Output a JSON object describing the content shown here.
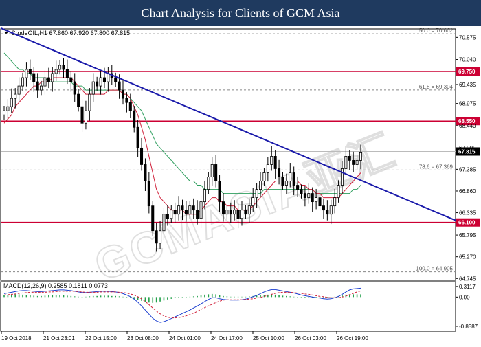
{
  "header": {
    "title": "Chart Analysis for Clients of GCM Asia"
  },
  "chart_data": [
    {
      "type": "candlestick",
      "title": "CrudeOIL,H1  67.860 67.920 67.800 67.815",
      "ohlc_label": "CrudeOIL,H1  67.860 67.920 67.800 67.815",
      "ylim": [
        64.7,
        70.78
      ],
      "y_ticks": [
        "70.575",
        "70.040",
        "69.435",
        "68.975",
        "68.440",
        "67.905",
        "67.385",
        "66.860",
        "66.335",
        "65.795",
        "65.270",
        "64.745"
      ],
      "x_ticks": [
        "19 Oct 2018",
        "21 Oct 23:01",
        "22 Oct 15:00",
        "23 Oct 08:00",
        "24 Oct 01:00",
        "24 Oct 17:00",
        "25 Oct 10:00",
        "26 Oct 03:00",
        "26 Oct 19:00"
      ],
      "current_price": "67.815",
      "horizontal_levels": [
        {
          "value": 69.75,
          "label": "69.750"
        },
        {
          "value": 68.55,
          "label": "68.550"
        },
        {
          "value": 66.1,
          "label": "66.100"
        }
      ],
      "fibonacci_levels": [
        {
          "value": 70.662,
          "label": "50.0 = 70.662"
        },
        {
          "value": 69.304,
          "label": "61.8 = 69.304"
        },
        {
          "value": 67.369,
          "label": "78.6 = 67.369"
        },
        {
          "value": 64.905,
          "label": "100.0 = 64.905"
        }
      ],
      "trendline": {
        "start_price": 70.8,
        "end_price": 66.15,
        "color": "#1a1aaa"
      },
      "closes": [
        68.8,
        68.9,
        69.1,
        69.2,
        69.4,
        69.6,
        69.8,
        69.7,
        69.5,
        69.3,
        69.4,
        69.6,
        69.5,
        69.7,
        69.8,
        69.9,
        69.8,
        69.6,
        69.5,
        69.2,
        68.9,
        68.5,
        68.8,
        69.2,
        69.5,
        69.4,
        69.6,
        69.5,
        69.7,
        69.6,
        69.5,
        69.3,
        69.1,
        69.0,
        68.8,
        68.4,
        67.9,
        67.5,
        67.1,
        66.5,
        65.9,
        65.6,
        65.9,
        66.3,
        66.2,
        66.4,
        66.3,
        66.5,
        66.4,
        66.3,
        66.5,
        66.4,
        66.2,
        66.6,
        66.9,
        67.2,
        67.5,
        67.1,
        66.6,
        66.3,
        66.4,
        66.3,
        66.4,
        66.2,
        66.4,
        66.3,
        66.5,
        66.7,
        66.9,
        67.1,
        67.3,
        67.5,
        67.7,
        67.4,
        67.2,
        67.0,
        67.1,
        67.3,
        67.0,
        66.9,
        66.8,
        66.7,
        66.8,
        66.6,
        66.7,
        66.5,
        66.4,
        66.3,
        66.5,
        66.7,
        67.0,
        67.4,
        67.7,
        67.6,
        67.5,
        67.6,
        67.8
      ],
      "ma_red": [
        68.5,
        68.6,
        68.7,
        68.9,
        69.0,
        69.1,
        69.2,
        69.3,
        69.4,
        69.4,
        69.5,
        69.5,
        69.5,
        69.6,
        69.6,
        69.6,
        69.6,
        69.6,
        69.6,
        69.5,
        69.4,
        69.3,
        69.2,
        69.2,
        69.2,
        69.2,
        69.2,
        69.2,
        69.3,
        69.3,
        69.3,
        69.3,
        69.2,
        69.2,
        69.1,
        68.9,
        68.7,
        68.4,
        68.1,
        67.7,
        67.3,
        66.9,
        66.7,
        66.6,
        66.5,
        66.4,
        66.4,
        66.4,
        66.4,
        66.3,
        66.3,
        66.3,
        66.3,
        66.4,
        66.5,
        66.6,
        66.7,
        66.7,
        66.6,
        66.6,
        66.5,
        66.5,
        66.5,
        66.4,
        66.4,
        66.4,
        66.4,
        66.5,
        66.6,
        66.7,
        66.8,
        66.9,
        67.0,
        67.1,
        67.1,
        67.1,
        67.1,
        67.1,
        67.1,
        67.1,
        67.0,
        67.0,
        66.9,
        66.9,
        66.8,
        66.8,
        66.7,
        66.7,
        66.7,
        66.7,
        66.7,
        66.8,
        66.9,
        67.0,
        67.1,
        67.2,
        67.3
      ],
      "ma_green": [
        70.2,
        70.1,
        70.0,
        69.9,
        69.8,
        69.8,
        69.7,
        69.7,
        69.6,
        69.6,
        69.6,
        69.6,
        69.5,
        69.5,
        69.5,
        69.5,
        69.5,
        69.5,
        69.5,
        69.4,
        69.4,
        69.4,
        69.3,
        69.3,
        69.3,
        69.3,
        69.3,
        69.3,
        69.3,
        69.3,
        69.3,
        69.3,
        69.2,
        69.2,
        69.1,
        69.0,
        68.9,
        68.8,
        68.6,
        68.4,
        68.2,
        68.0,
        67.9,
        67.8,
        67.7,
        67.6,
        67.5,
        67.4,
        67.3,
        67.2,
        67.1,
        67.1,
        67.0,
        67.0,
        66.9,
        66.9,
        66.9,
        66.9,
        66.9,
        66.8,
        66.8,
        66.8,
        66.8,
        66.8,
        66.8,
        66.8,
        66.8,
        66.8,
        66.8,
        66.8,
        66.9,
        66.9,
        66.9,
        66.9,
        66.9,
        66.9,
        66.9,
        66.9,
        66.9,
        66.9,
        66.9,
        66.9,
        66.9,
        66.9,
        66.8,
        66.8,
        66.8,
        66.8,
        66.8,
        66.8,
        66.8,
        66.8,
        66.8,
        66.8,
        66.9,
        66.9,
        67.0
      ]
    },
    {
      "type": "macd",
      "title": "MACD(12,26,9) 0.2585 0.1811 0.0773",
      "label": "MACD(12,26,9) 0.2585 0.1811 0.0773",
      "ylim": [
        -1.0,
        0.45
      ],
      "y_ticks": [
        "0.3117",
        "0.00",
        "-0.8587"
      ],
      "histogram": [
        0.05,
        0.06,
        0.07,
        0.08,
        0.08,
        0.07,
        0.06,
        0.05,
        0.04,
        0.03,
        0.03,
        0.04,
        0.05,
        0.05,
        0.06,
        0.06,
        0.05,
        0.04,
        0.03,
        0.02,
        0.01,
        0.0,
        0.01,
        0.02,
        0.03,
        0.03,
        0.04,
        0.04,
        0.04,
        0.03,
        0.03,
        0.02,
        0.01,
        -0.01,
        -0.03,
        -0.05,
        -0.08,
        -0.11,
        -0.14,
        -0.16,
        -0.17,
        -0.16,
        -0.13,
        -0.1,
        -0.07,
        -0.05,
        -0.03,
        -0.02,
        -0.01,
        0.0,
        0.01,
        0.02,
        0.03,
        0.05,
        0.07,
        0.08,
        0.09,
        0.08,
        0.05,
        0.03,
        0.02,
        0.01,
        0.01,
        0.01,
        0.01,
        0.01,
        0.02,
        0.03,
        0.04,
        0.05,
        0.06,
        0.07,
        0.08,
        0.07,
        0.05,
        0.04,
        0.03,
        0.02,
        0.01,
        0.0,
        -0.01,
        -0.02,
        -0.02,
        -0.03,
        -0.03,
        -0.03,
        -0.03,
        -0.02,
        -0.01,
        0.01,
        0.03,
        0.05,
        0.07,
        0.08,
        0.08,
        0.08,
        0.08
      ],
      "macd": [
        0.1,
        0.12,
        0.14,
        0.16,
        0.18,
        0.19,
        0.19,
        0.18,
        0.17,
        0.16,
        0.16,
        0.17,
        0.18,
        0.19,
        0.2,
        0.21,
        0.21,
        0.2,
        0.19,
        0.17,
        0.15,
        0.13,
        0.13,
        0.14,
        0.15,
        0.16,
        0.17,
        0.17,
        0.17,
        0.16,
        0.15,
        0.13,
        0.1,
        0.06,
        0.01,
        -0.06,
        -0.15,
        -0.26,
        -0.38,
        -0.5,
        -0.62,
        -0.7,
        -0.74,
        -0.72,
        -0.68,
        -0.63,
        -0.58,
        -0.53,
        -0.48,
        -0.43,
        -0.38,
        -0.32,
        -0.26,
        -0.2,
        -0.13,
        -0.07,
        -0.02,
        -0.02,
        -0.05,
        -0.07,
        -0.08,
        -0.09,
        -0.09,
        -0.09,
        -0.08,
        -0.06,
        -0.03,
        0.01,
        0.05,
        0.1,
        0.15,
        0.19,
        0.22,
        0.22,
        0.2,
        0.18,
        0.16,
        0.14,
        0.12,
        0.09,
        0.06,
        0.04,
        0.02,
        0.0,
        -0.02,
        -0.03,
        -0.05,
        -0.06,
        -0.05,
        -0.02,
        0.02,
        0.08,
        0.15,
        0.21,
        0.24,
        0.25,
        0.26
      ],
      "signal": [
        0.06,
        0.07,
        0.08,
        0.09,
        0.11,
        0.12,
        0.13,
        0.14,
        0.14,
        0.14,
        0.14,
        0.14,
        0.15,
        0.15,
        0.16,
        0.17,
        0.17,
        0.17,
        0.17,
        0.17,
        0.16,
        0.15,
        0.14,
        0.14,
        0.14,
        0.14,
        0.15,
        0.15,
        0.15,
        0.15,
        0.15,
        0.14,
        0.13,
        0.12,
        0.09,
        0.06,
        0.01,
        -0.05,
        -0.13,
        -0.22,
        -0.32,
        -0.41,
        -0.49,
        -0.55,
        -0.59,
        -0.61,
        -0.61,
        -0.6,
        -0.58,
        -0.55,
        -0.51,
        -0.47,
        -0.42,
        -0.36,
        -0.31,
        -0.26,
        -0.21,
        -0.16,
        -0.12,
        -0.09,
        -0.08,
        -0.08,
        -0.08,
        -0.08,
        -0.08,
        -0.07,
        -0.06,
        -0.05,
        -0.03,
        -0.01,
        0.02,
        0.05,
        0.08,
        0.11,
        0.13,
        0.14,
        0.14,
        0.14,
        0.13,
        0.12,
        0.11,
        0.09,
        0.08,
        0.06,
        0.04,
        0.02,
        0.01,
        -0.01,
        -0.02,
        -0.02,
        -0.02,
        0.0,
        0.03,
        0.07,
        0.11,
        0.15,
        0.18
      ]
    }
  ]
}
